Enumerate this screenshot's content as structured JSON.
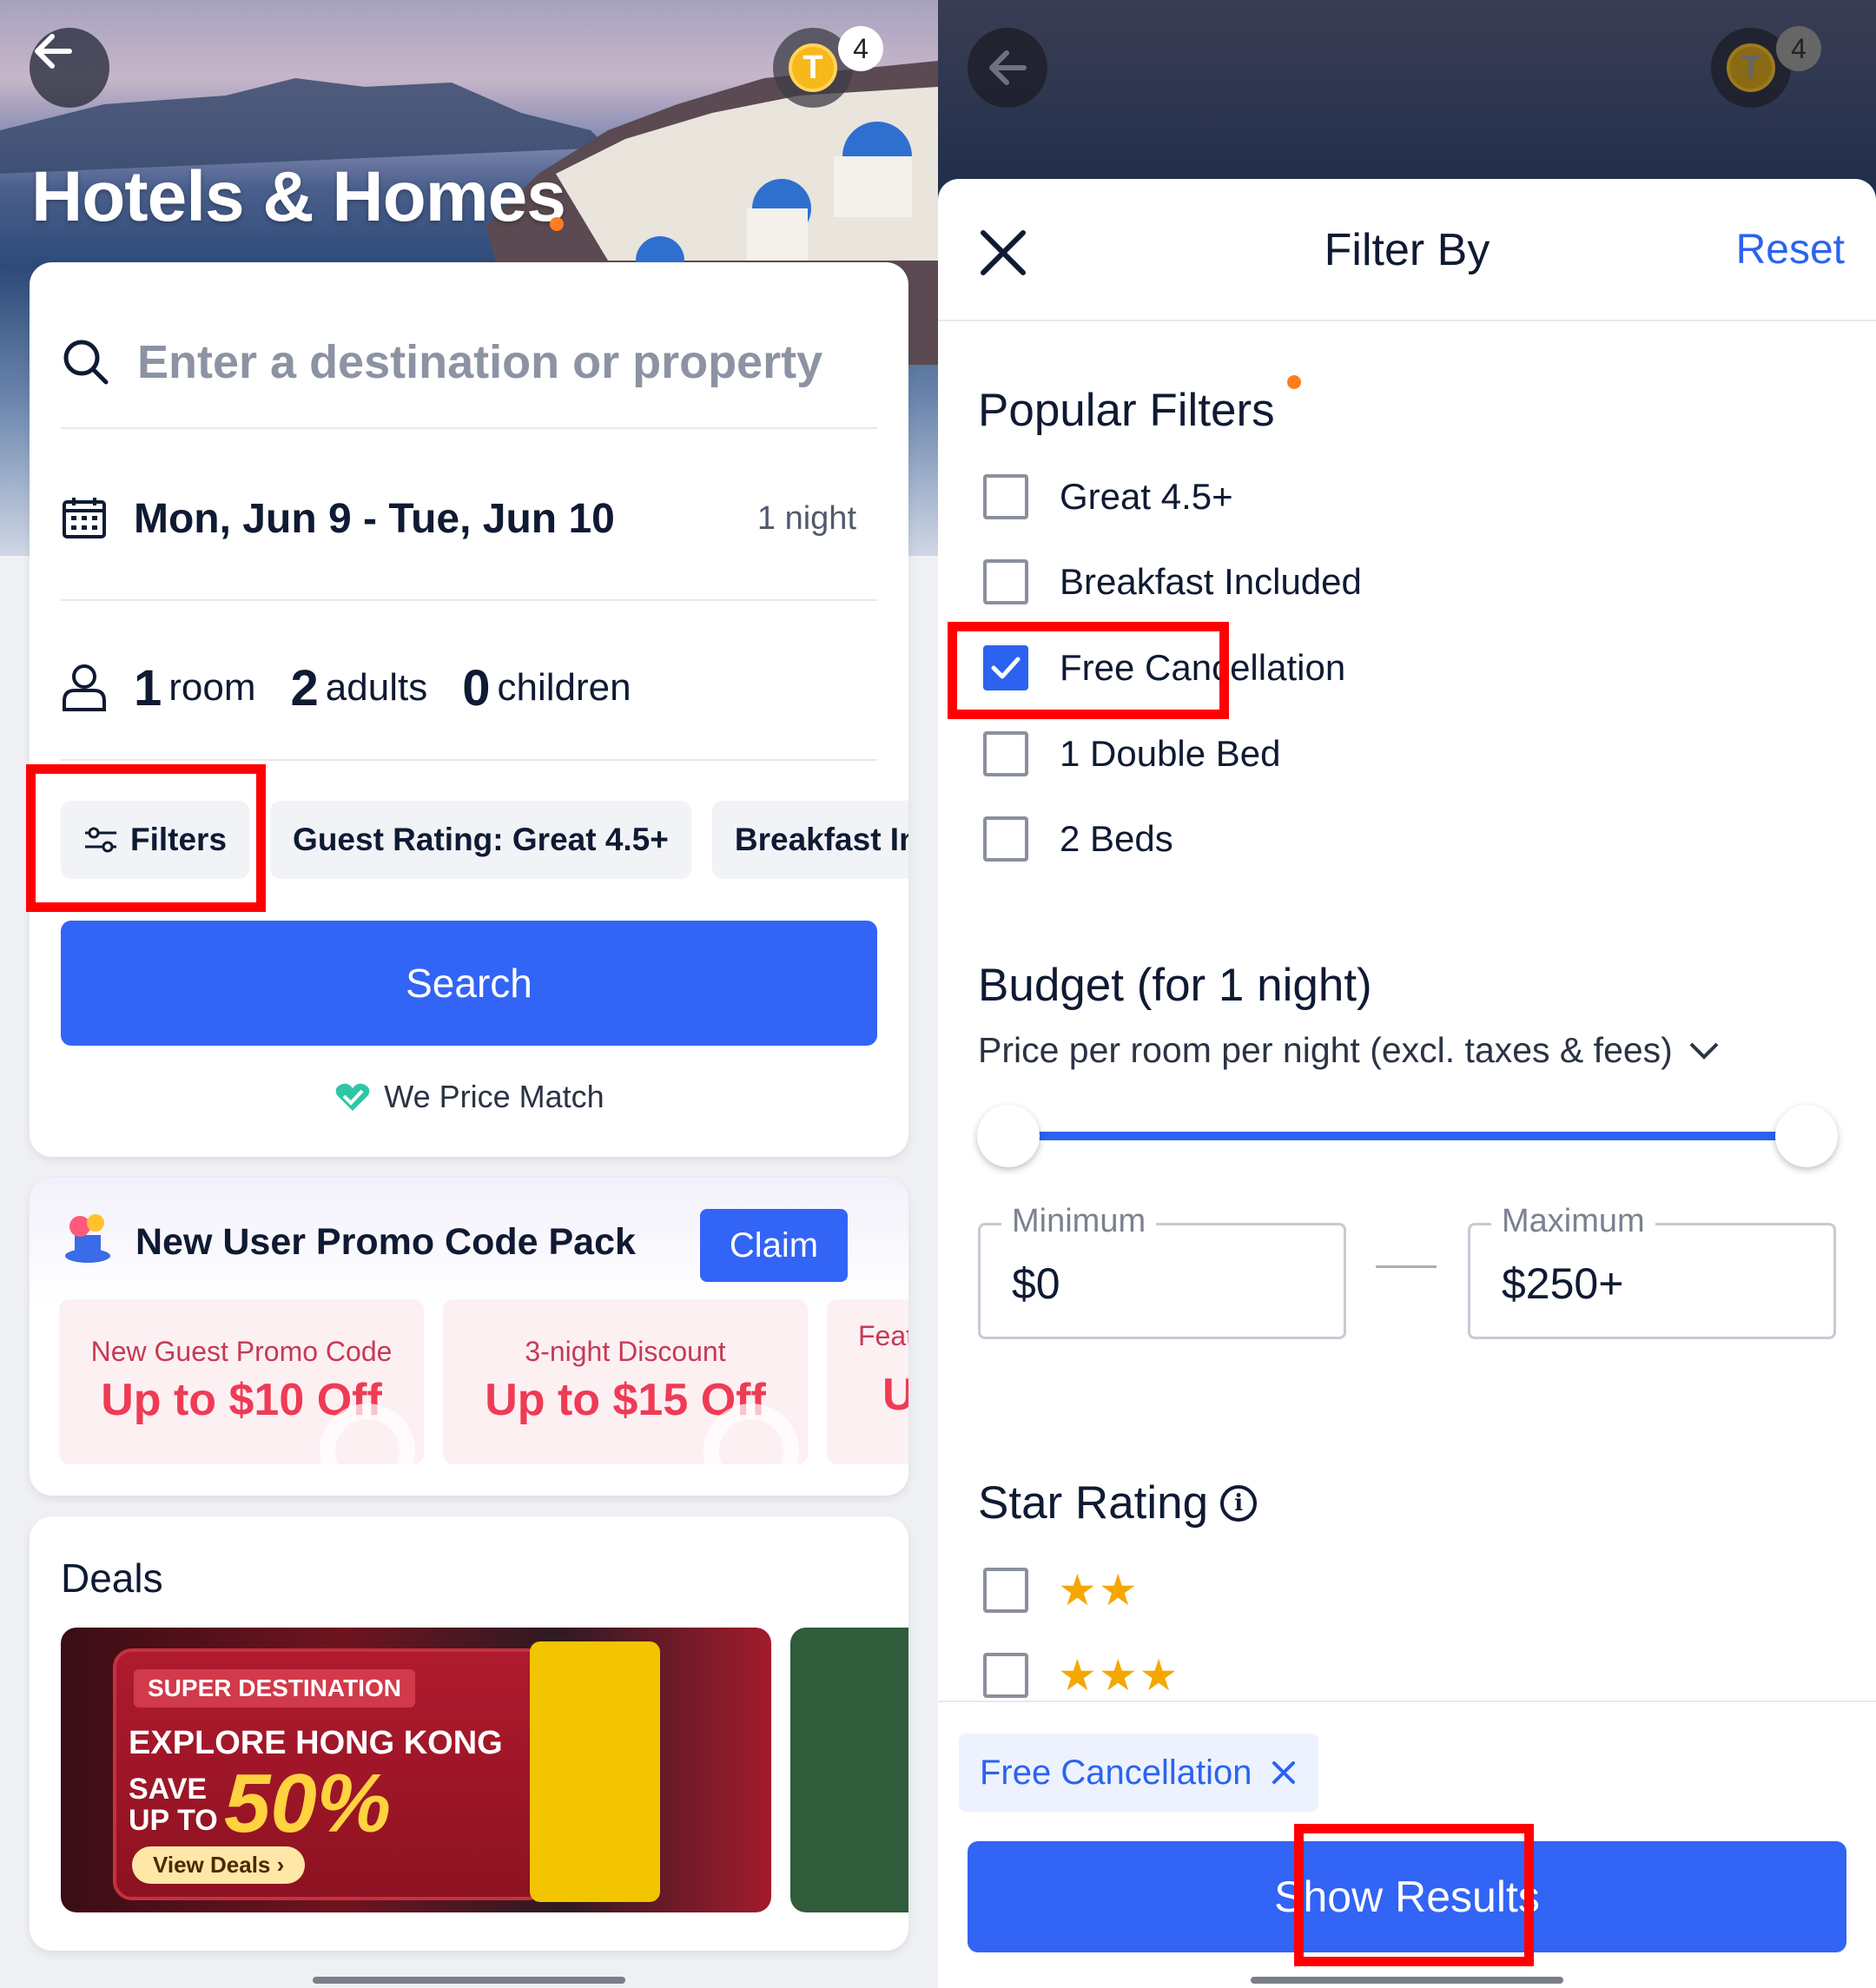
{
  "left": {
    "hero_title": "Hotels & Homes",
    "coin_letter": "T",
    "coin_count": "4",
    "search": {
      "placeholder": "Enter a destination or property",
      "dates": "Mon, Jun 9 - Tue, Jun 10",
      "nights": "1 night",
      "rooms_num": "1",
      "rooms_lbl": "room",
      "adults_num": "2",
      "adults_lbl": "adults",
      "children_num": "0",
      "children_lbl": "children",
      "chips": [
        "Filters",
        "Guest Rating: Great 4.5+",
        "Breakfast Inclu"
      ],
      "search_label": "Search",
      "price_match": "We Price Match"
    },
    "promo": {
      "title": "New User Promo Code Pack",
      "claim": "Claim",
      "coupons": [
        {
          "label": "New Guest Promo Code",
          "value": "Up to $10 Off"
        },
        {
          "label": "3-night Discount",
          "value": "Up to $15 Off"
        },
        {
          "label": "Feat",
          "value": "U"
        }
      ]
    },
    "deals": {
      "title": "Deals",
      "banner": {
        "tag": "SUPER DESTINATION",
        "headline": "EXPLORE HONG KONG",
        "save1": "SAVE",
        "save2": "UP TO",
        "percent": "50%",
        "cta": "View Deals ›"
      }
    }
  },
  "right": {
    "sheet_title": "Filter By",
    "reset": "Reset",
    "popular_title": "Popular Filters",
    "popular": [
      {
        "label": "Great 4.5+",
        "checked": false
      },
      {
        "label": "Breakfast Included",
        "checked": false
      },
      {
        "label": "Free Cancellation",
        "checked": true
      },
      {
        "label": "1 Double Bed",
        "checked": false
      },
      {
        "label": "2 Beds",
        "checked": false
      }
    ],
    "budget_title": "Budget (for 1 night)",
    "budget_sub": "Price per room per night (excl. taxes & fees)",
    "min_label": "Minimum",
    "min_value": "$0",
    "max_label": "Maximum",
    "max_value": "$250+",
    "star_title": "Star Rating",
    "stars": [
      "★★",
      "★★★"
    ],
    "selected_chip": "Free Cancellation",
    "show_results": "Show Results"
  },
  "colors": {
    "accent": "#3264f6",
    "highlight": "#ff0000",
    "star": "#f5a700"
  }
}
